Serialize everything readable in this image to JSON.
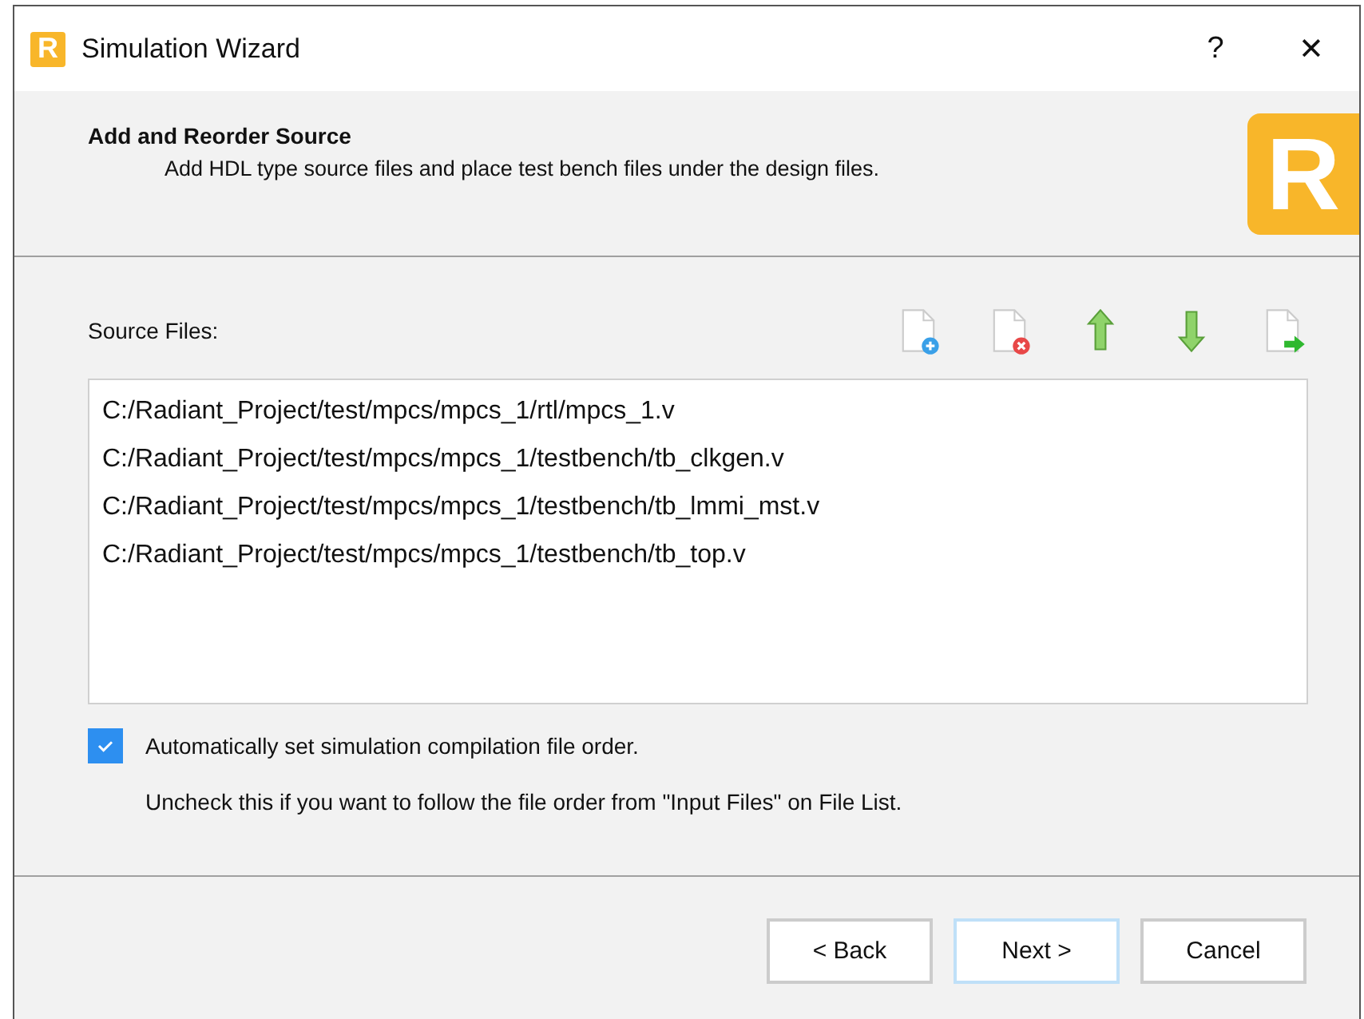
{
  "window": {
    "title": "Simulation Wizard",
    "logo_letter": "R",
    "help": "?",
    "close": "✕"
  },
  "header": {
    "title": "Add and Reorder Source",
    "subtitle": "Add HDL type source files and place test bench files under the design files.",
    "logo_letter": "R"
  },
  "source_files": {
    "label": "Source Files:",
    "toolbar": [
      {
        "kind": "add"
      },
      {
        "kind": "remove"
      },
      {
        "kind": "up"
      },
      {
        "kind": "down"
      },
      {
        "kind": "export"
      }
    ],
    "items": [
      "C:/Radiant_Project/test/mpcs/mpcs_1/rtl/mpcs_1.v",
      "C:/Radiant_Project/test/mpcs/mpcs_1/testbench/tb_clkgen.v",
      "C:/Radiant_Project/test/mpcs/mpcs_1/testbench/tb_lmmi_mst.v",
      "C:/Radiant_Project/test/mpcs/mpcs_1/testbench/tb_top.v"
    ]
  },
  "auto_order": {
    "label": "Automatically set simulation compilation file order.",
    "checked": true,
    "note": "Uncheck this if you want to follow the file order from \"Input Files\" on File List."
  },
  "buttons": [
    {
      "label": "< Back",
      "default": false
    },
    {
      "label": "Next >",
      "default": true
    },
    {
      "label": "Cancel",
      "default": false
    }
  ]
}
